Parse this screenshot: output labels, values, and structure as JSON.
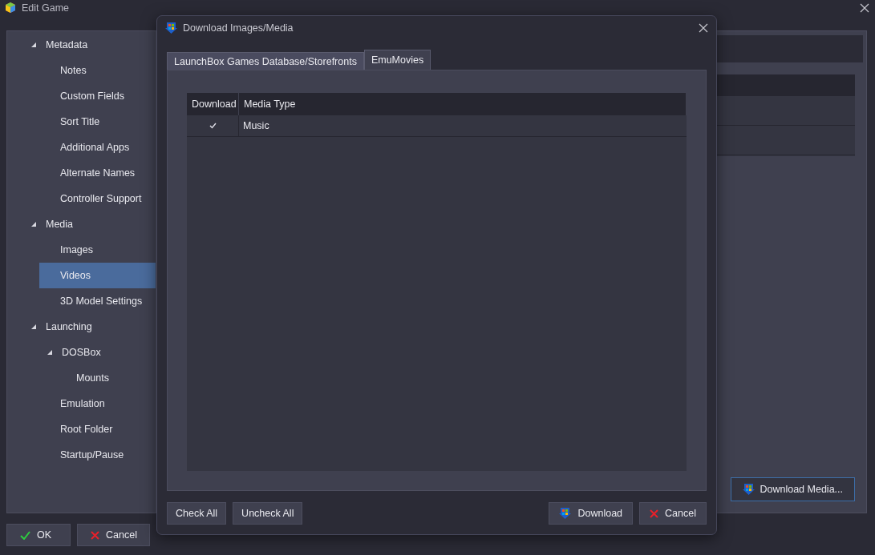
{
  "window": {
    "title": "Edit Game"
  },
  "sidebar": {
    "items": [
      {
        "label": "Metadata",
        "expanded": true,
        "selected": false,
        "children": [
          {
            "label": "Notes",
            "selected": false
          },
          {
            "label": "Custom Fields",
            "selected": false
          },
          {
            "label": "Sort Title",
            "selected": false
          },
          {
            "label": "Additional Apps",
            "selected": false
          },
          {
            "label": "Alternate Names",
            "selected": false
          },
          {
            "label": "Controller Support",
            "selected": false
          }
        ]
      },
      {
        "label": "Media",
        "expanded": true,
        "selected": false,
        "children": [
          {
            "label": "Images",
            "selected": false
          },
          {
            "label": "Videos",
            "selected": true
          },
          {
            "label": "3D Model Settings",
            "selected": false
          }
        ]
      },
      {
        "label": "Launching",
        "expanded": true,
        "selected": false,
        "children": [
          {
            "label": "DOSBox",
            "expanded": true,
            "selected": false,
            "children": [
              {
                "label": "Mounts",
                "selected": false
              }
            ]
          },
          {
            "label": "Emulation",
            "selected": false
          },
          {
            "label": "Root Folder",
            "selected": false
          },
          {
            "label": "Startup/Pause",
            "selected": false
          }
        ]
      }
    ]
  },
  "panel_button": {
    "label": "Download Media..."
  },
  "buttons": [
    {
      "kind": "ok",
      "label": "OK"
    },
    {
      "kind": "cancel",
      "label": "Cancel"
    }
  ],
  "dialog": {
    "title": "Download Images/Media",
    "tabs": [
      {
        "label": "LaunchBox Games Database/Storefronts",
        "selected": false
      },
      {
        "label": "EmuMovies",
        "selected": true
      }
    ],
    "table": {
      "columns": [
        "Download",
        "Media Type"
      ],
      "rows": [
        {
          "checked": true,
          "media_type": "Music"
        }
      ]
    },
    "left_buttons": [
      {
        "label": "Check All"
      },
      {
        "label": "Uncheck All"
      }
    ],
    "right_buttons": [
      {
        "kind": "download",
        "label": "Download"
      },
      {
        "kind": "cancel",
        "label": "Cancel"
      }
    ]
  }
}
